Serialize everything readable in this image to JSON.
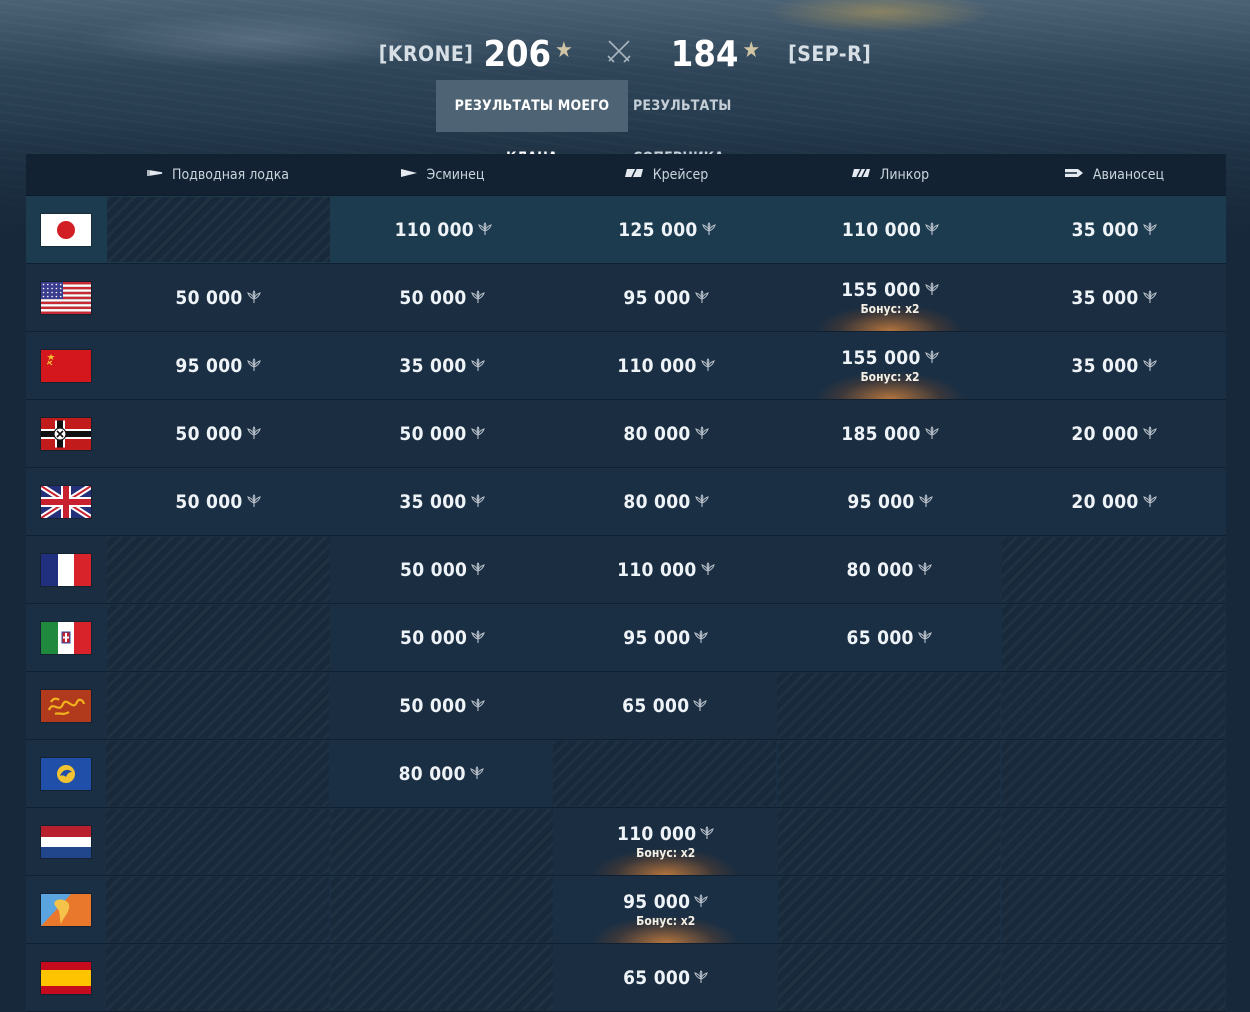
{
  "header": {
    "left_clan": "[KRONE]",
    "left_score": "206",
    "right_score": "184",
    "right_clan": "[SEP-R]"
  },
  "tabs": [
    {
      "label": "РЕЗУЛЬТАТЫ МОЕГО КЛАНА",
      "active": true
    },
    {
      "label": "РЕЗУЛЬТАТЫ СОПЕРНИКА",
      "active": false
    }
  ],
  "columns": [
    {
      "label": "Подводная лодка",
      "icon": "submarine-icon"
    },
    {
      "label": "Эсминец",
      "icon": "destroyer-icon"
    },
    {
      "label": "Крейсер",
      "icon": "cruiser-icon"
    },
    {
      "label": "Линкор",
      "icon": "battleship-icon"
    },
    {
      "label": "Авианосец",
      "icon": "carrier-icon"
    }
  ],
  "currency_icon": "coal-icon",
  "rows": [
    {
      "nation": "japan-flag",
      "cells": [
        {
          "empty": true
        },
        {
          "value": "110 000"
        },
        {
          "value": "125 000"
        },
        {
          "value": "110 000"
        },
        {
          "value": "35 000"
        }
      ]
    },
    {
      "nation": "usa-flag",
      "cells": [
        {
          "value": "50 000"
        },
        {
          "value": "50 000"
        },
        {
          "value": "95 000"
        },
        {
          "value": "155 000",
          "bonus": "Бонус: x2"
        },
        {
          "value": "35 000"
        }
      ]
    },
    {
      "nation": "ussr-flag",
      "cells": [
        {
          "value": "95 000"
        },
        {
          "value": "35 000"
        },
        {
          "value": "110 000"
        },
        {
          "value": "155 000",
          "bonus": "Бонус: x2"
        },
        {
          "value": "35 000"
        }
      ]
    },
    {
      "nation": "germany-flag",
      "cells": [
        {
          "value": "50 000"
        },
        {
          "value": "50 000"
        },
        {
          "value": "80 000"
        },
        {
          "value": "185 000"
        },
        {
          "value": "20 000"
        }
      ]
    },
    {
      "nation": "uk-flag",
      "cells": [
        {
          "value": "50 000"
        },
        {
          "value": "35 000"
        },
        {
          "value": "80 000"
        },
        {
          "value": "95 000"
        },
        {
          "value": "20 000"
        }
      ]
    },
    {
      "nation": "france-flag",
      "cells": [
        {
          "empty": true
        },
        {
          "value": "50 000"
        },
        {
          "value": "110 000"
        },
        {
          "value": "80 000"
        },
        {
          "empty": true
        }
      ]
    },
    {
      "nation": "italy-flag",
      "cells": [
        {
          "empty": true
        },
        {
          "value": "50 000"
        },
        {
          "value": "95 000"
        },
        {
          "value": "65 000"
        },
        {
          "empty": true
        }
      ]
    },
    {
      "nation": "pan-asia-flag",
      "cells": [
        {
          "empty": true
        },
        {
          "value": "50 000"
        },
        {
          "value": "65 000"
        },
        {
          "empty": true
        },
        {
          "empty": true
        }
      ]
    },
    {
      "nation": "europe-flag",
      "cells": [
        {
          "empty": true
        },
        {
          "value": "80 000"
        },
        {
          "empty": true
        },
        {
          "empty": true
        },
        {
          "empty": true
        }
      ]
    },
    {
      "nation": "netherlands-flag",
      "cells": [
        {
          "empty": true
        },
        {
          "empty": true
        },
        {
          "value": "110 000",
          "bonus": "Бонус: x2"
        },
        {
          "empty": true
        },
        {
          "empty": true
        }
      ]
    },
    {
      "nation": "pan-america-flag",
      "cells": [
        {
          "empty": true
        },
        {
          "empty": true
        },
        {
          "value": "95 000",
          "bonus": "Бонус: x2"
        },
        {
          "empty": true
        },
        {
          "empty": true
        }
      ]
    },
    {
      "nation": "spain-flag",
      "cells": [
        {
          "empty": true
        },
        {
          "empty": true
        },
        {
          "value": "65 000"
        },
        {
          "empty": true
        },
        {
          "empty": true
        }
      ]
    }
  ]
}
